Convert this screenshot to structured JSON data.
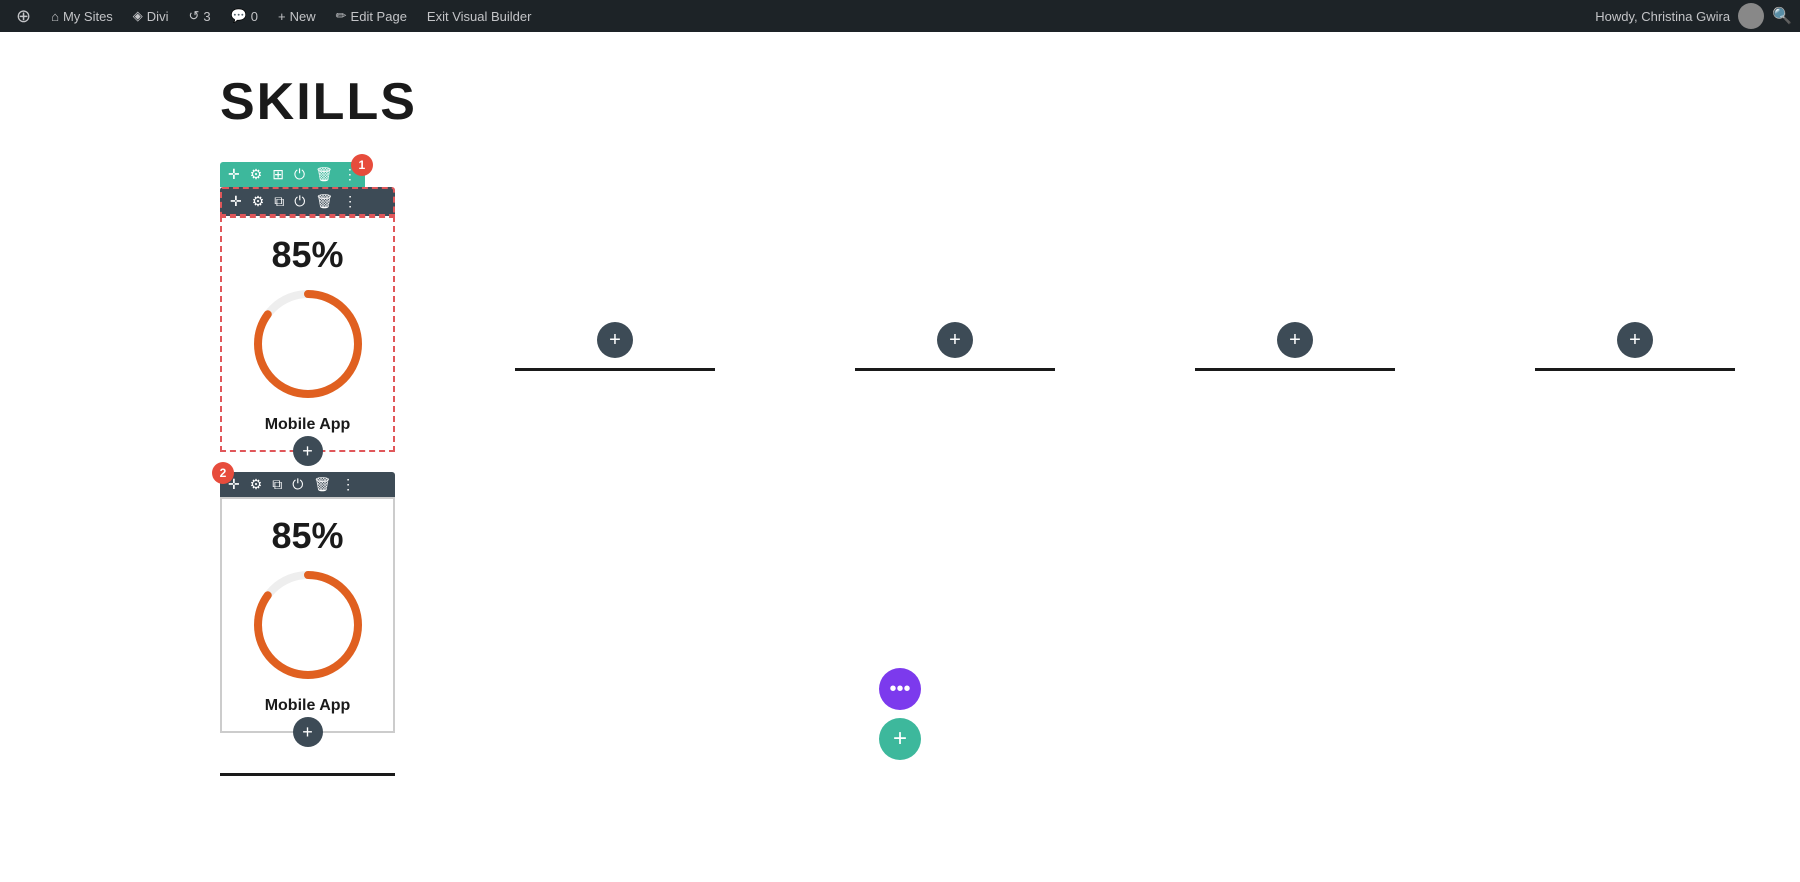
{
  "adminBar": {
    "wpIcon": "⊕",
    "mySites": "My Sites",
    "divi": "Divi",
    "updates": "3",
    "comments": "0",
    "new": "New",
    "editPage": "Edit Page",
    "exitBuilder": "Exit Visual Builder",
    "howdy": "Howdy, Christina Gwira"
  },
  "page": {
    "title": "SKILLS"
  },
  "rowToolbar": {
    "badge": "1",
    "icons": [
      "move",
      "settings",
      "grid",
      "visibility",
      "delete",
      "more"
    ]
  },
  "colToolbar1": {
    "icons": [
      "move",
      "settings",
      "duplicate",
      "visibility",
      "delete",
      "more"
    ]
  },
  "colToolbar2": {
    "badge": "2",
    "icons": [
      "move",
      "settings",
      "duplicate",
      "visibility",
      "delete",
      "more"
    ]
  },
  "cards": [
    {
      "percent": "85%",
      "label": "Mobile App",
      "value": 85
    },
    {
      "percent": "85%",
      "label": "Mobile App",
      "value": 85
    }
  ],
  "colPlaceholders": [
    {
      "id": 1
    },
    {
      "id": 2
    },
    {
      "id": 3
    },
    {
      "id": 4
    }
  ],
  "floatingButtons": {
    "more": "•••",
    "add": "+"
  }
}
